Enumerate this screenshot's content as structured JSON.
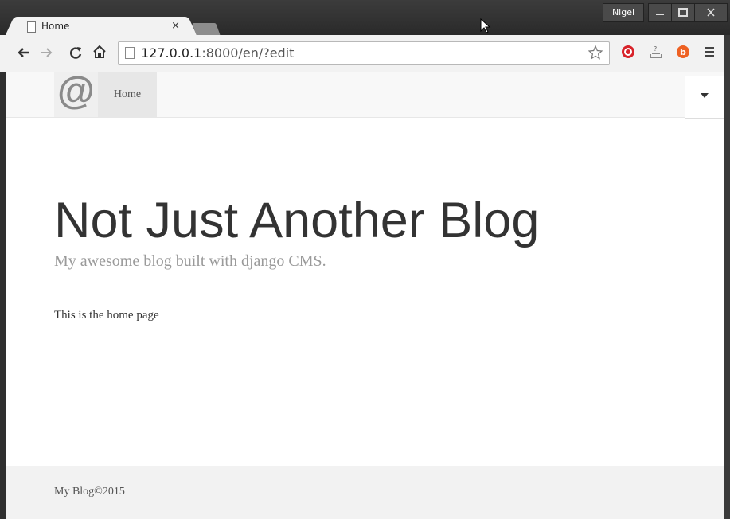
{
  "browser": {
    "tab_title": "Home",
    "tab_close": "×",
    "user_name": "Nigel",
    "url_host": "127.0.0.1",
    "url_rest": ":8000/en/?edit"
  },
  "site": {
    "nav_home": "Home",
    "brand_symbol": "@",
    "title": "Not Just Another Blog",
    "tagline": "My awesome blog built with django CMS.",
    "content": "This is the home page",
    "footer": "My Blog©2015"
  }
}
